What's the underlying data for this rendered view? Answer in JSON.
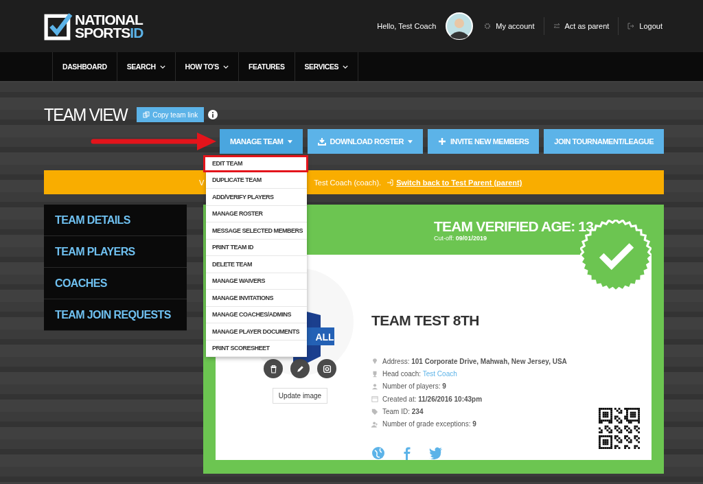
{
  "header": {
    "logo": {
      "line1": "NATIONAL",
      "line2": "SPORTS",
      "accent": "ID"
    },
    "greeting": "Hello, Test Coach",
    "links": [
      {
        "kind": "gear",
        "label": "My account"
      },
      {
        "kind": "swap",
        "label": "Act as parent"
      },
      {
        "kind": "logout",
        "label": "Logout"
      }
    ]
  },
  "nav": [
    {
      "label": "DASHBOARD",
      "dropdown": false
    },
    {
      "label": "SEARCH",
      "dropdown": true
    },
    {
      "label": "HOW TO'S",
      "dropdown": true
    },
    {
      "label": "FEATURES",
      "dropdown": false
    },
    {
      "label": "SERVICES",
      "dropdown": true
    }
  ],
  "page": {
    "title": "TEAM VIEW",
    "copy_button": "Copy team link"
  },
  "actions": [
    {
      "kind": "caret",
      "label": "MANAGE TEAM",
      "expanded": true
    },
    {
      "kind": "download",
      "label": "DOWNLOAD ROSTER",
      "expanded": false
    },
    {
      "kind": "plus",
      "label": "INVITE NEW MEMBERS",
      "expanded": false
    },
    {
      "kind": "none",
      "label": "JOIN TOURNAMENT/LEAGUE",
      "expanded": false
    }
  ],
  "manage_menu": [
    {
      "label": "EDIT TEAM",
      "selected": true
    },
    {
      "label": "DUPLICATE TEAM",
      "selected": false
    },
    {
      "label": "ADD/VERIFY PLAYERS",
      "selected": false
    },
    {
      "label": "MANAGE ROSTER",
      "selected": false
    },
    {
      "label": "MESSAGE SELECTED MEMBERS",
      "selected": false
    },
    {
      "label": "PRINT TEAM ID",
      "selected": false
    },
    {
      "label": "DELETE TEAM",
      "selected": false
    },
    {
      "label": "MANAGE WAIVERS",
      "selected": false
    },
    {
      "label": "MANAGE INVITATIONS",
      "selected": false
    },
    {
      "label": "MANAGE COACHES/ADMINS",
      "selected": false
    },
    {
      "label": "MANAGE PLAYER DOCUMENTS",
      "selected": false
    },
    {
      "label": "PRINT SCORESHEET",
      "selected": false
    }
  ],
  "banner": {
    "text_start": "V",
    "text": "Test Coach (coach).",
    "link": "Switch back to Test Parent (parent)"
  },
  "sidebar": [
    {
      "label": "TEAM DETAILS"
    },
    {
      "label": "TEAM PLAYERS"
    },
    {
      "label": "COACHES"
    },
    {
      "label": "TEAM JOIN REQUESTS"
    }
  ],
  "card": {
    "verified_title": "TEAM VERIFIED AGE: 13",
    "cutoff_label": "Cut-off:",
    "cutoff": "09/01/2019",
    "logo_text": "ALL",
    "image_actions": [
      {
        "kind": "trash"
      },
      {
        "kind": "pencil"
      },
      {
        "kind": "camera"
      }
    ],
    "update_image": "Update image",
    "team_name": "TEAM TEST 8TH",
    "info": [
      {
        "kind": "pin",
        "label": "Address:",
        "value": "101 Corporate Drive, Mahwah, New Jersey, USA",
        "link": false
      },
      {
        "kind": "trophy",
        "label": "Head coach:",
        "value": "Test Coach",
        "link": true
      },
      {
        "kind": "user",
        "label": "Number of players:",
        "value": "9",
        "link": false
      },
      {
        "kind": "calendar",
        "label": "Created at:",
        "value": "11/26/2016 10:43pm",
        "link": false
      },
      {
        "kind": "tag",
        "label": "Team ID:",
        "value": "234",
        "link": false
      },
      {
        "kind": "user-plus",
        "label": "Number of grade exceptions:",
        "value": "9",
        "link": false
      }
    ],
    "social": [
      {
        "kind": "globe"
      },
      {
        "kind": "facebook"
      },
      {
        "kind": "twitter"
      }
    ]
  }
}
